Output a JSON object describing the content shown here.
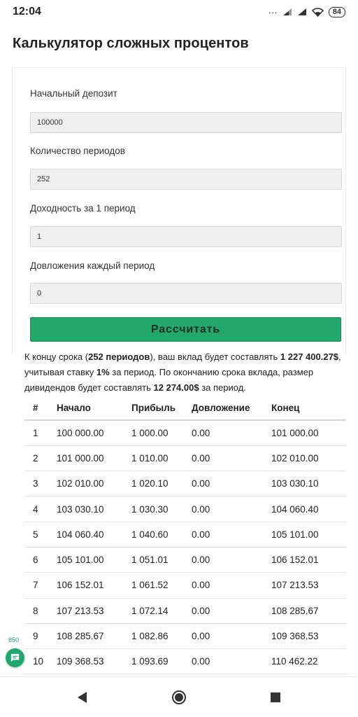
{
  "status_bar": {
    "time": "12:04",
    "battery": "84"
  },
  "page": {
    "title": "Калькулятор сложных процентов"
  },
  "form": {
    "deposit_label": "Начальный депозит",
    "deposit_value": "100000",
    "periods_label": "Количество периодов",
    "periods_value": "252",
    "yield_label": "Доходность за 1 период",
    "yield_value": "1",
    "contribution_label": "Довложения каждый период",
    "contribution_value": "0",
    "calculate_label": "Рассчитать"
  },
  "summary": {
    "t1": "К концу срока (",
    "periods": "252 периодов",
    "t2": "), ваш вклад будет составлять ",
    "total": "1 227 400.27$",
    "t3": ", учитывая ставку ",
    "rate": "1%",
    "t4": " за период. По окончанию срока вклада, размер дивидендов будет составлять ",
    "dividend": "12 274.00$",
    "t5": " за период."
  },
  "table": {
    "headers": [
      "#",
      "Начало",
      "Прибыль",
      "Довложение",
      "Конец"
    ],
    "rows": [
      [
        "1",
        "100 000.00",
        "1 000.00",
        "0.00",
        "101 000.00"
      ],
      [
        "2",
        "101 000.00",
        "1 010.00",
        "0.00",
        "102 010.00"
      ],
      [
        "3",
        "102 010.00",
        "1 020.10",
        "0.00",
        "103 030.10"
      ],
      [
        "4",
        "103 030.10",
        "1 030.30",
        "0.00",
        "104 060.40"
      ],
      [
        "5",
        "104 060.40",
        "1 040.60",
        "0.00",
        "105 101.00"
      ],
      [
        "6",
        "105 101.00",
        "1 051.01",
        "0.00",
        "106 152.01"
      ],
      [
        "7",
        "106 152.01",
        "1 061.52",
        "0.00",
        "107 213.53"
      ],
      [
        "8",
        "107 213.53",
        "1 072.14",
        "0.00",
        "108 285.67"
      ],
      [
        "9",
        "108 285.67",
        "1 082.86",
        "0.00",
        "109 368.53"
      ],
      [
        "10",
        "109 368.53",
        "1 093.69",
        "0.00",
        "110 462.22"
      ]
    ]
  },
  "badge": {
    "views": "850",
    "icon": "chat-icon"
  },
  "colors": {
    "accent": "#22a86a",
    "input_bg": "#efefef"
  }
}
